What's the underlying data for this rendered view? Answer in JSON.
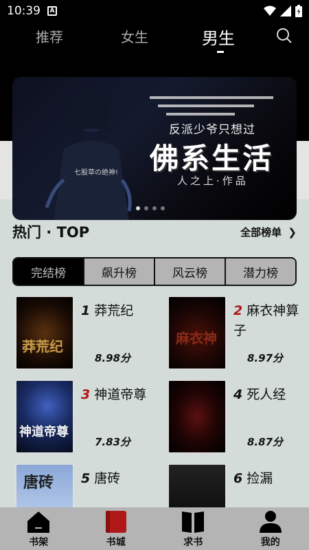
{
  "status_bar": {
    "time": "10:39",
    "app_badge": "A"
  },
  "top_tabs": [
    {
      "label": "推荐",
      "active": false
    },
    {
      "label": "女生",
      "active": false
    },
    {
      "label": "男生",
      "active": true
    }
  ],
  "banner": {
    "subtitle": "反派少爷只想过",
    "title": "佛系生活",
    "author": "人之上·作品",
    "tag": "七股草の绝神!",
    "slide_count": 4,
    "active_slide": 1
  },
  "section": {
    "title": "热门 · TOP",
    "more_label": "全部榜单"
  },
  "rank_tabs": [
    {
      "label": "完结榜",
      "active": true
    },
    {
      "label": "飙升榜",
      "active": false
    },
    {
      "label": "风云榜",
      "active": false
    },
    {
      "label": "潜力榜",
      "active": false
    }
  ],
  "books": [
    {
      "rank": "1",
      "title": "莽荒纪",
      "score": "8.98分",
      "cover_text": "莽荒纪"
    },
    {
      "rank": "2",
      "title": "麻衣神算子",
      "score": "8.97分",
      "cover_text": "麻衣神"
    },
    {
      "rank": "3",
      "title": "神道帝尊",
      "score": "7.83分",
      "cover_text": "神道帝尊"
    },
    {
      "rank": "4",
      "title": "死人经",
      "score": "8.87分",
      "cover_text": ""
    },
    {
      "rank": "5",
      "title": "唐砖",
      "score": "",
      "cover_text": "唐砖"
    },
    {
      "rank": "6",
      "title": "捡漏",
      "score": "",
      "cover_text": ""
    }
  ],
  "bottom_nav": [
    {
      "label": "书架",
      "icon": "house-icon",
      "active": false
    },
    {
      "label": "书城",
      "icon": "book-icon",
      "active": true
    },
    {
      "label": "求书",
      "icon": "open-book-icon",
      "active": false
    },
    {
      "label": "我的",
      "icon": "person-icon",
      "active": false
    }
  ],
  "colors": {
    "accent": "#b01818",
    "background": "#d3dcd9",
    "nav_bg": "#b4b4b4"
  }
}
